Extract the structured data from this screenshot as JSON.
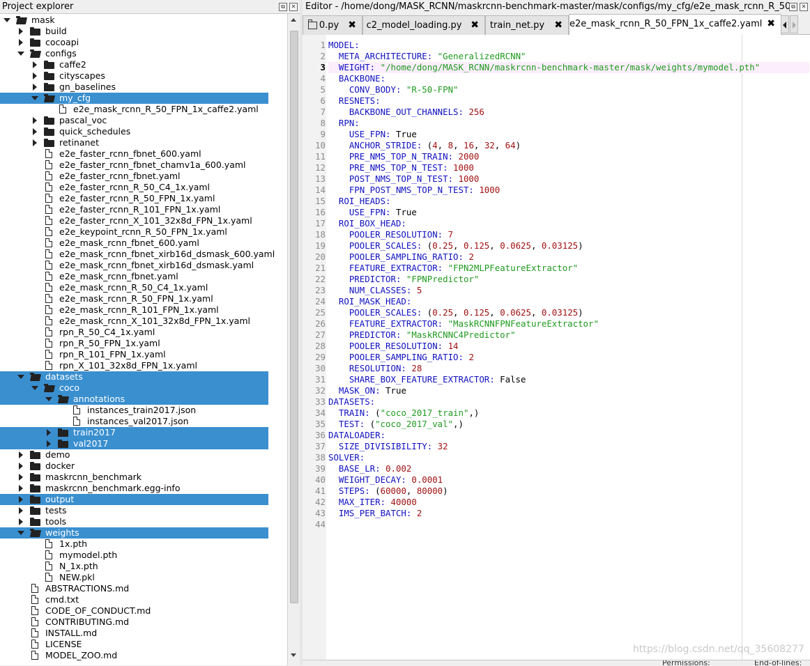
{
  "explorer": {
    "title": "Project explorer",
    "items": [
      {
        "label": "mask",
        "type": "folder",
        "depth": 0,
        "open": true,
        "sel": false
      },
      {
        "label": "build",
        "type": "folder",
        "depth": 1,
        "open": false,
        "sel": false
      },
      {
        "label": "cocoapi",
        "type": "folder",
        "depth": 1,
        "open": false,
        "sel": false
      },
      {
        "label": "configs",
        "type": "folder",
        "depth": 1,
        "open": true,
        "sel": false
      },
      {
        "label": "caffe2",
        "type": "folder",
        "depth": 2,
        "open": false,
        "sel": false
      },
      {
        "label": "cityscapes",
        "type": "folder",
        "depth": 2,
        "open": false,
        "sel": false
      },
      {
        "label": "gn_baselines",
        "type": "folder",
        "depth": 2,
        "open": false,
        "sel": false
      },
      {
        "label": "my_cfg",
        "type": "folder",
        "depth": 2,
        "open": true,
        "sel": true
      },
      {
        "label": "e2e_mask_rcnn_R_50_FPN_1x_caffe2.yaml",
        "type": "file",
        "depth": 3,
        "sel": false
      },
      {
        "label": "pascal_voc",
        "type": "folder",
        "depth": 2,
        "open": false,
        "sel": false
      },
      {
        "label": "quick_schedules",
        "type": "folder",
        "depth": 2,
        "open": false,
        "sel": false
      },
      {
        "label": "retinanet",
        "type": "folder",
        "depth": 2,
        "open": false,
        "sel": false
      },
      {
        "label": "e2e_faster_rcnn_fbnet_600.yaml",
        "type": "file",
        "depth": 2,
        "sel": false
      },
      {
        "label": "e2e_faster_rcnn_fbnet_chamv1a_600.yaml",
        "type": "file",
        "depth": 2,
        "sel": false
      },
      {
        "label": "e2e_faster_rcnn_fbnet.yaml",
        "type": "file",
        "depth": 2,
        "sel": false
      },
      {
        "label": "e2e_faster_rcnn_R_50_C4_1x.yaml",
        "type": "file",
        "depth": 2,
        "sel": false
      },
      {
        "label": "e2e_faster_rcnn_R_50_FPN_1x.yaml",
        "type": "file",
        "depth": 2,
        "sel": false
      },
      {
        "label": "e2e_faster_rcnn_R_101_FPN_1x.yaml",
        "type": "file",
        "depth": 2,
        "sel": false
      },
      {
        "label": "e2e_faster_rcnn_X_101_32x8d_FPN_1x.yaml",
        "type": "file",
        "depth": 2,
        "sel": false
      },
      {
        "label": "e2e_keypoint_rcnn_R_50_FPN_1x.yaml",
        "type": "file",
        "depth": 2,
        "sel": false
      },
      {
        "label": "e2e_mask_rcnn_fbnet_600.yaml",
        "type": "file",
        "depth": 2,
        "sel": false
      },
      {
        "label": "e2e_mask_rcnn_fbnet_xirb16d_dsmask_600.yaml",
        "type": "file",
        "depth": 2,
        "sel": false
      },
      {
        "label": "e2e_mask_rcnn_fbnet_xirb16d_dsmask.yaml",
        "type": "file",
        "depth": 2,
        "sel": false
      },
      {
        "label": "e2e_mask_rcnn_fbnet.yaml",
        "type": "file",
        "depth": 2,
        "sel": false
      },
      {
        "label": "e2e_mask_rcnn_R_50_C4_1x.yaml",
        "type": "file",
        "depth": 2,
        "sel": false
      },
      {
        "label": "e2e_mask_rcnn_R_50_FPN_1x.yaml",
        "type": "file",
        "depth": 2,
        "sel": false
      },
      {
        "label": "e2e_mask_rcnn_R_101_FPN_1x.yaml",
        "type": "file",
        "depth": 2,
        "sel": false
      },
      {
        "label": "e2e_mask_rcnn_X_101_32x8d_FPN_1x.yaml",
        "type": "file",
        "depth": 2,
        "sel": false
      },
      {
        "label": "rpn_R_50_C4_1x.yaml",
        "type": "file",
        "depth": 2,
        "sel": false
      },
      {
        "label": "rpn_R_50_FPN_1x.yaml",
        "type": "file",
        "depth": 2,
        "sel": false
      },
      {
        "label": "rpn_R_101_FPN_1x.yaml",
        "type": "file",
        "depth": 2,
        "sel": false
      },
      {
        "label": "rpn_X_101_32x8d_FPN_1x.yaml",
        "type": "file",
        "depth": 2,
        "sel": false
      },
      {
        "label": "datasets",
        "type": "folder",
        "depth": 1,
        "open": true,
        "sel": true
      },
      {
        "label": "coco",
        "type": "folder",
        "depth": 2,
        "open": true,
        "sel": true
      },
      {
        "label": "annotations",
        "type": "folder",
        "depth": 3,
        "open": true,
        "sel": true
      },
      {
        "label": "instances_train2017.json",
        "type": "file",
        "depth": 4,
        "sel": false
      },
      {
        "label": "instances_val2017.json",
        "type": "file",
        "depth": 4,
        "sel": false
      },
      {
        "label": "train2017",
        "type": "folder",
        "depth": 3,
        "open": false,
        "sel": true
      },
      {
        "label": "val2017",
        "type": "folder",
        "depth": 3,
        "open": false,
        "sel": true
      },
      {
        "label": "demo",
        "type": "folder",
        "depth": 1,
        "open": false,
        "sel": false
      },
      {
        "label": "docker",
        "type": "folder",
        "depth": 1,
        "open": false,
        "sel": false
      },
      {
        "label": "maskrcnn_benchmark",
        "type": "folder",
        "depth": 1,
        "open": false,
        "sel": false
      },
      {
        "label": "maskrcnn_benchmark.egg-info",
        "type": "folder",
        "depth": 1,
        "open": false,
        "sel": false
      },
      {
        "label": "output",
        "type": "folder",
        "depth": 1,
        "open": false,
        "sel": true
      },
      {
        "label": "tests",
        "type": "folder",
        "depth": 1,
        "open": false,
        "sel": false
      },
      {
        "label": "tools",
        "type": "folder",
        "depth": 1,
        "open": false,
        "sel": false
      },
      {
        "label": "weights",
        "type": "folder",
        "depth": 1,
        "open": true,
        "sel": true
      },
      {
        "label": "1x.pth",
        "type": "file",
        "depth": 2,
        "sel": false
      },
      {
        "label": "mymodel.pth",
        "type": "file",
        "depth": 2,
        "sel": false
      },
      {
        "label": "N_1x.pth",
        "type": "file",
        "depth": 2,
        "sel": false
      },
      {
        "label": "NEW.pkl",
        "type": "file",
        "depth": 2,
        "sel": false
      },
      {
        "label": "ABSTRACTIONS.md",
        "type": "file",
        "depth": 1,
        "sel": false
      },
      {
        "label": "cmd.txt",
        "type": "file",
        "depth": 1,
        "sel": false
      },
      {
        "label": "CODE_OF_CONDUCT.md",
        "type": "file",
        "depth": 1,
        "sel": false
      },
      {
        "label": "CONTRIBUTING.md",
        "type": "file",
        "depth": 1,
        "sel": false
      },
      {
        "label": "INSTALL.md",
        "type": "file",
        "depth": 1,
        "sel": false
      },
      {
        "label": "LICENSE",
        "type": "file",
        "depth": 1,
        "sel": false
      },
      {
        "label": "MODEL_ZOO.md",
        "type": "file",
        "depth": 1,
        "sel": false
      }
    ]
  },
  "editor": {
    "title": "Editor - /home/dong/MASK_RCNN/maskrcnn-benchmark-master/mask/configs/my_cfg/e2e_mask_rcnn_R_50_FPN_1x...",
    "tabs": [
      {
        "label": "0.py",
        "active": false
      },
      {
        "label": "c2_model_loading.py",
        "active": false
      },
      {
        "label": "train_net.py",
        "active": false
      },
      {
        "label": "e2e_mask_rcnn_R_50_FPN_1x_caffe2.yaml",
        "active": true
      }
    ],
    "close_glyph": "✖",
    "current_line": 3,
    "lines": [
      [
        [
          "k",
          "MODEL:"
        ]
      ],
      [
        [
          "k",
          "  META_ARCHITECTURE:"
        ],
        [
          "p",
          " "
        ],
        [
          "s",
          "\"GeneralizedRCNN\""
        ]
      ],
      [
        [
          "k",
          "  WEIGHT:"
        ],
        [
          "p",
          " "
        ],
        [
          "s",
          "\"/home/dong/MASK_RCNN/maskrcnn-benchmark-master/mask/weights/mymodel.pth\""
        ]
      ],
      [
        [
          "k",
          "  BACKBONE:"
        ]
      ],
      [
        [
          "k",
          "    CONV_BODY:"
        ],
        [
          "p",
          " "
        ],
        [
          "s",
          "\"R-50-FPN\""
        ]
      ],
      [
        [
          "k",
          "  RESNETS:"
        ]
      ],
      [
        [
          "k",
          "    BACKBONE_OUT_CHANNELS:"
        ],
        [
          "p",
          " "
        ],
        [
          "n",
          "256"
        ]
      ],
      [
        [
          "k",
          "  RPN:"
        ]
      ],
      [
        [
          "k",
          "    USE_FPN:"
        ],
        [
          "p",
          " True"
        ]
      ],
      [
        [
          "k",
          "    ANCHOR_STRIDE:"
        ],
        [
          "p",
          " ("
        ],
        [
          "n",
          "4"
        ],
        [
          "p",
          ", "
        ],
        [
          "n",
          "8"
        ],
        [
          "p",
          ", "
        ],
        [
          "n",
          "16"
        ],
        [
          "p",
          ", "
        ],
        [
          "n",
          "32"
        ],
        [
          "p",
          ", "
        ],
        [
          "n",
          "64"
        ],
        [
          "p",
          ")"
        ]
      ],
      [
        [
          "k",
          "    PRE_NMS_TOP_N_TRAIN:"
        ],
        [
          "p",
          " "
        ],
        [
          "n",
          "2000"
        ]
      ],
      [
        [
          "k",
          "    PRE_NMS_TOP_N_TEST:"
        ],
        [
          "p",
          " "
        ],
        [
          "n",
          "1000"
        ]
      ],
      [
        [
          "k",
          "    POST_NMS_TOP_N_TEST:"
        ],
        [
          "p",
          " "
        ],
        [
          "n",
          "1000"
        ]
      ],
      [
        [
          "k",
          "    FPN_POST_NMS_TOP_N_TEST:"
        ],
        [
          "p",
          " "
        ],
        [
          "n",
          "1000"
        ]
      ],
      [
        [
          "k",
          "  ROI_HEADS:"
        ]
      ],
      [
        [
          "k",
          "    USE_FPN:"
        ],
        [
          "p",
          " True"
        ]
      ],
      [
        [
          "k",
          "  ROI_BOX_HEAD:"
        ]
      ],
      [
        [
          "k",
          "    POOLER_RESOLUTION:"
        ],
        [
          "p",
          " "
        ],
        [
          "n",
          "7"
        ]
      ],
      [
        [
          "k",
          "    POOLER_SCALES:"
        ],
        [
          "p",
          " ("
        ],
        [
          "n",
          "0.25"
        ],
        [
          "p",
          ", "
        ],
        [
          "n",
          "0.125"
        ],
        [
          "p",
          ", "
        ],
        [
          "n",
          "0.0625"
        ],
        [
          "p",
          ", "
        ],
        [
          "n",
          "0.03125"
        ],
        [
          "p",
          ")"
        ]
      ],
      [
        [
          "k",
          "    POOLER_SAMPLING_RATIO:"
        ],
        [
          "p",
          " "
        ],
        [
          "n",
          "2"
        ]
      ],
      [
        [
          "k",
          "    FEATURE_EXTRACTOR:"
        ],
        [
          "p",
          " "
        ],
        [
          "s",
          "\"FPN2MLPFeatureExtractor\""
        ]
      ],
      [
        [
          "k",
          "    PREDICTOR:"
        ],
        [
          "p",
          " "
        ],
        [
          "s",
          "\"FPNPredictor\""
        ]
      ],
      [
        [
          "k",
          "    NUM_CLASSES:"
        ],
        [
          "p",
          " "
        ],
        [
          "n",
          "5"
        ]
      ],
      [
        [
          "k",
          "  ROI_MASK_HEAD:"
        ]
      ],
      [
        [
          "k",
          "    POOLER_SCALES:"
        ],
        [
          "p",
          " ("
        ],
        [
          "n",
          "0.25"
        ],
        [
          "p",
          ", "
        ],
        [
          "n",
          "0.125"
        ],
        [
          "p",
          ", "
        ],
        [
          "n",
          "0.0625"
        ],
        [
          "p",
          ", "
        ],
        [
          "n",
          "0.03125"
        ],
        [
          "p",
          ")"
        ]
      ],
      [
        [
          "k",
          "    FEATURE_EXTRACTOR:"
        ],
        [
          "p",
          " "
        ],
        [
          "s",
          "\"MaskRCNNFPNFeatureExtractor\""
        ]
      ],
      [
        [
          "k",
          "    PREDICTOR:"
        ],
        [
          "p",
          " "
        ],
        [
          "s",
          "\"MaskRCNNC4Predictor\""
        ]
      ],
      [
        [
          "k",
          "    POOLER_RESOLUTION:"
        ],
        [
          "p",
          " "
        ],
        [
          "n",
          "14"
        ]
      ],
      [
        [
          "k",
          "    POOLER_SAMPLING_RATIO:"
        ],
        [
          "p",
          " "
        ],
        [
          "n",
          "2"
        ]
      ],
      [
        [
          "k",
          "    RESOLUTION:"
        ],
        [
          "p",
          " "
        ],
        [
          "n",
          "28"
        ]
      ],
      [
        [
          "k",
          "    SHARE_BOX_FEATURE_EXTRACTOR:"
        ],
        [
          "p",
          " False"
        ]
      ],
      [
        [
          "k",
          "  MASK_ON:"
        ],
        [
          "p",
          " True"
        ]
      ],
      [
        [
          "k",
          "DATASETS:"
        ]
      ],
      [
        [
          "k",
          "  TRAIN:"
        ],
        [
          "p",
          " ("
        ],
        [
          "s",
          "\"coco_2017_train\""
        ],
        [
          "p",
          ",)"
        ]
      ],
      [
        [
          "k",
          "  TEST:"
        ],
        [
          "p",
          " ("
        ],
        [
          "s",
          "\"coco_2017_val\""
        ],
        [
          "p",
          ",)"
        ]
      ],
      [
        [
          "k",
          "DATALOADER:"
        ]
      ],
      [
        [
          "k",
          "  SIZE_DIVISIBILITY:"
        ],
        [
          "p",
          " "
        ],
        [
          "n",
          "32"
        ]
      ],
      [
        [
          "k",
          "SOLVER:"
        ]
      ],
      [
        [
          "k",
          "  BASE_LR:"
        ],
        [
          "p",
          " "
        ],
        [
          "n",
          "0.002"
        ]
      ],
      [
        [
          "k",
          "  WEIGHT_DECAY:"
        ],
        [
          "p",
          " "
        ],
        [
          "n",
          "0.0001"
        ]
      ],
      [
        [
          "k",
          "  STEPS:"
        ],
        [
          "p",
          " ("
        ],
        [
          "n",
          "60000"
        ],
        [
          "p",
          ", "
        ],
        [
          "n",
          "80000"
        ],
        [
          "p",
          ")"
        ]
      ],
      [
        [
          "k",
          "  MAX_ITER:"
        ],
        [
          "p",
          " "
        ],
        [
          "n",
          "40000"
        ]
      ],
      [
        [
          "k",
          "  IMS_PER_BATCH:"
        ],
        [
          "p",
          " "
        ],
        [
          "n",
          "2"
        ]
      ],
      [
        [
          "p",
          ""
        ]
      ]
    ]
  },
  "watermark": "https://blog.csdn.net/qq_35608277",
  "status": {
    "left": "Permissions:",
    "right": "End-of-lines:"
  },
  "colors": {
    "selection": "#3a8fcf",
    "keyword": "#1010c0",
    "string": "#1f9a1f",
    "number": "#a01010",
    "current_line": "#fceefc"
  }
}
